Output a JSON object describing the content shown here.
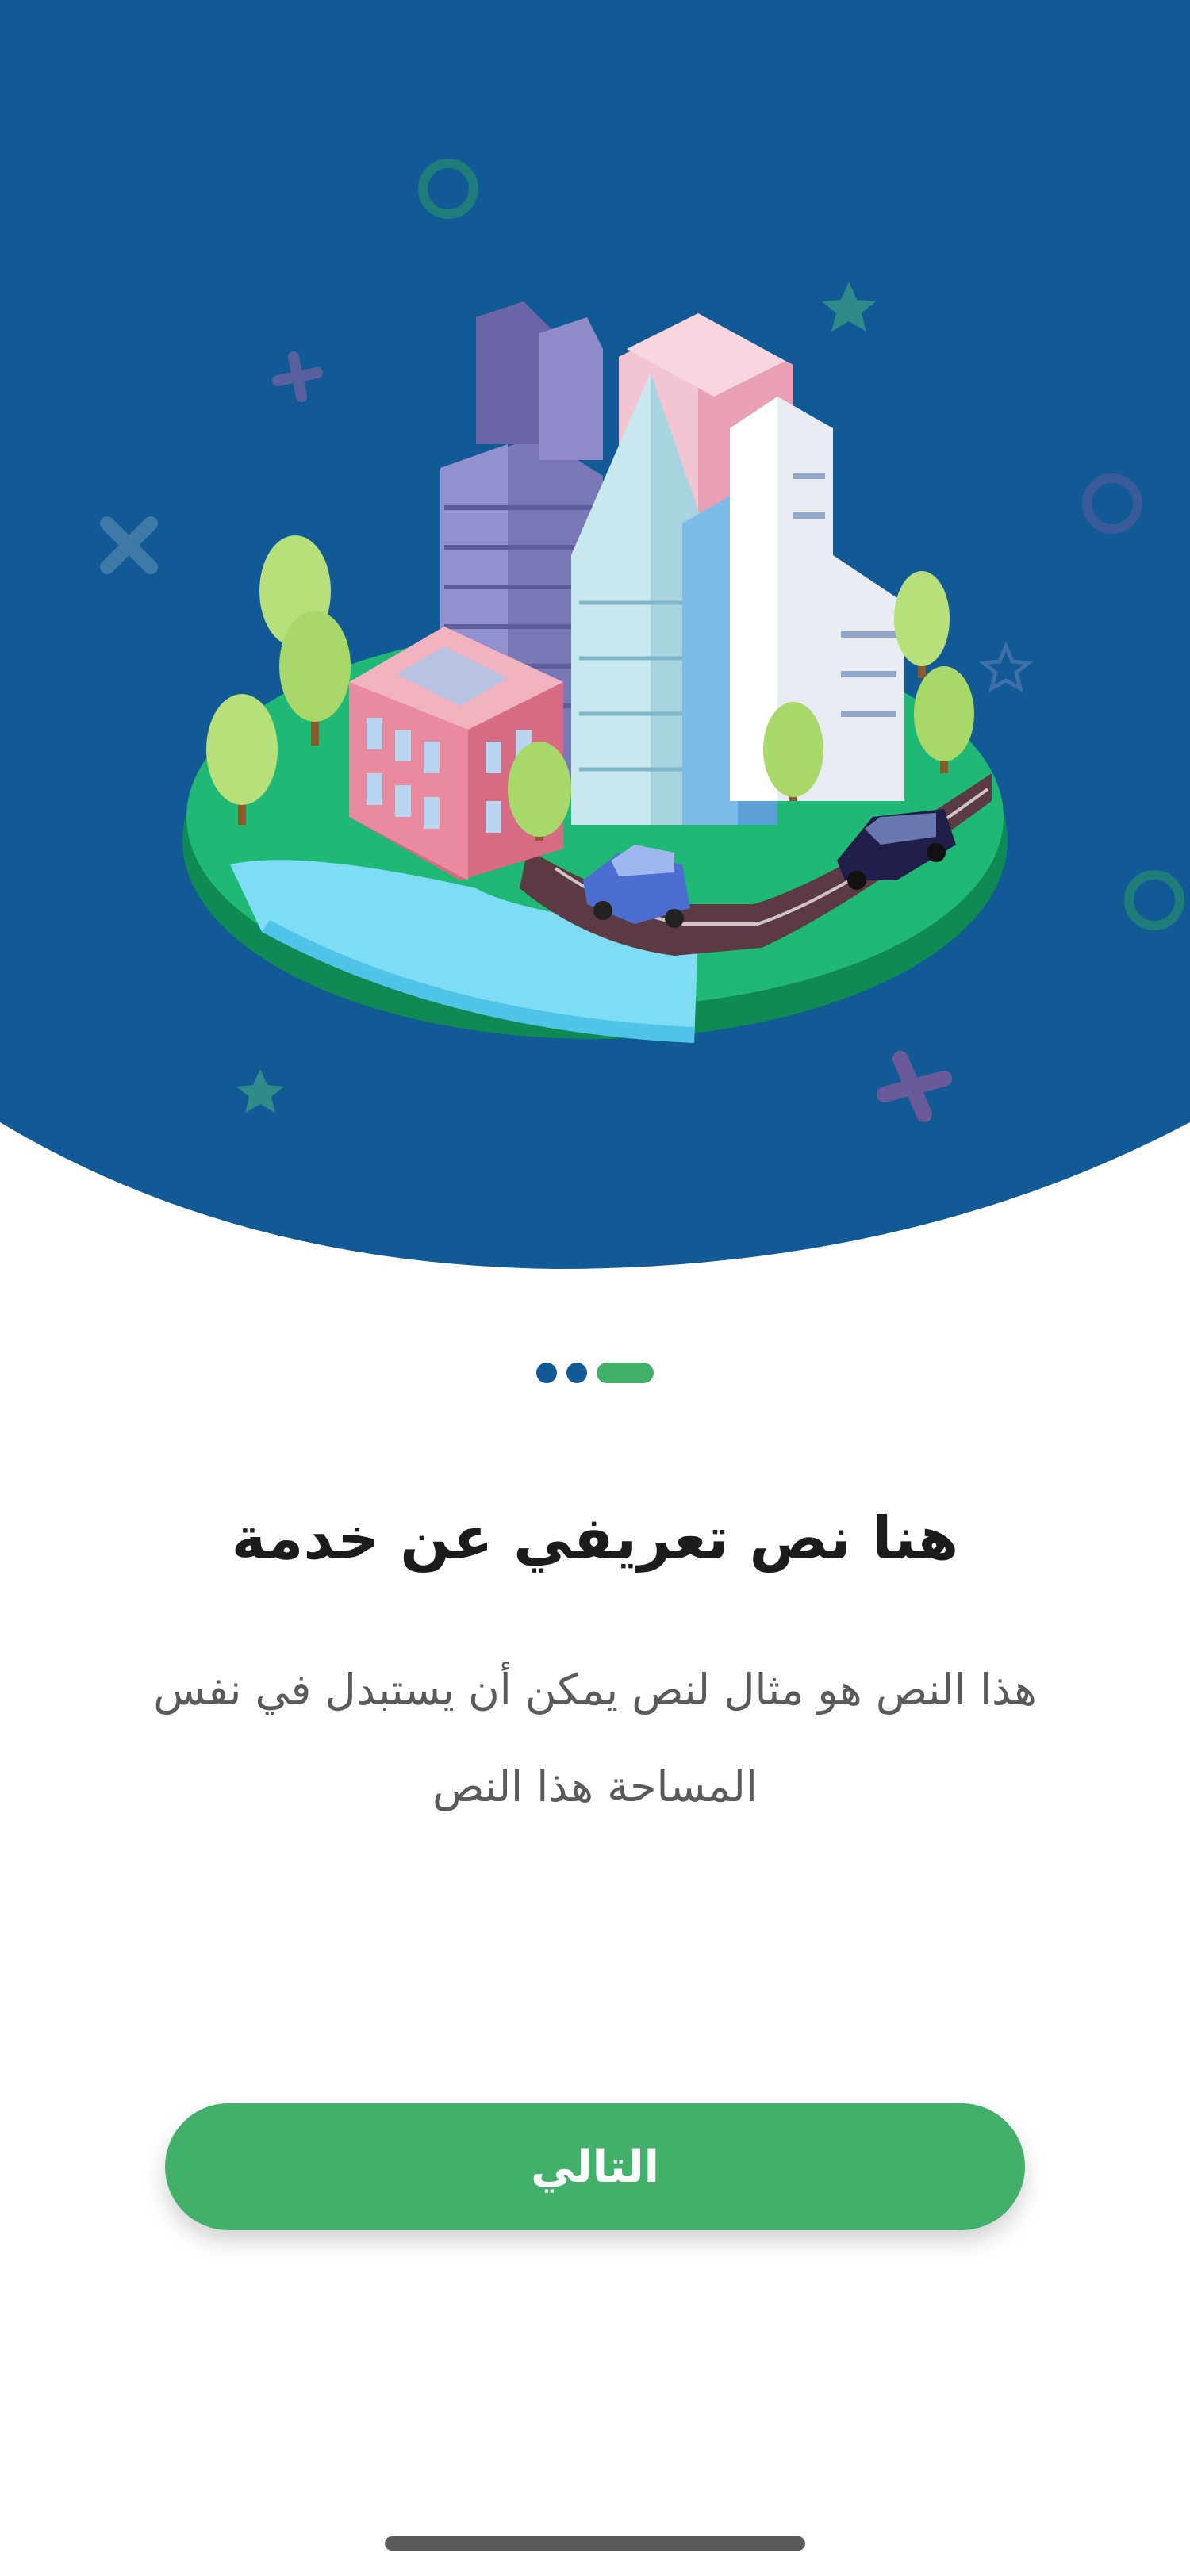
{
  "colors": {
    "header_bg": "#115a95",
    "accent_green": "#42b06b",
    "dot_blue": "#115a95",
    "home_indicator": "#5a5a5a"
  },
  "illustration": {
    "icon": "isometric-city-illustration"
  },
  "pagination": {
    "total": 3,
    "current": 3
  },
  "content": {
    "title": "هنا نص تعريفي عن خدمة",
    "description": "هذا النص هو مثال لنص يمكن أن يستبدل في نفس المساحة هذا النص"
  },
  "actions": {
    "next_label": "التالي"
  }
}
